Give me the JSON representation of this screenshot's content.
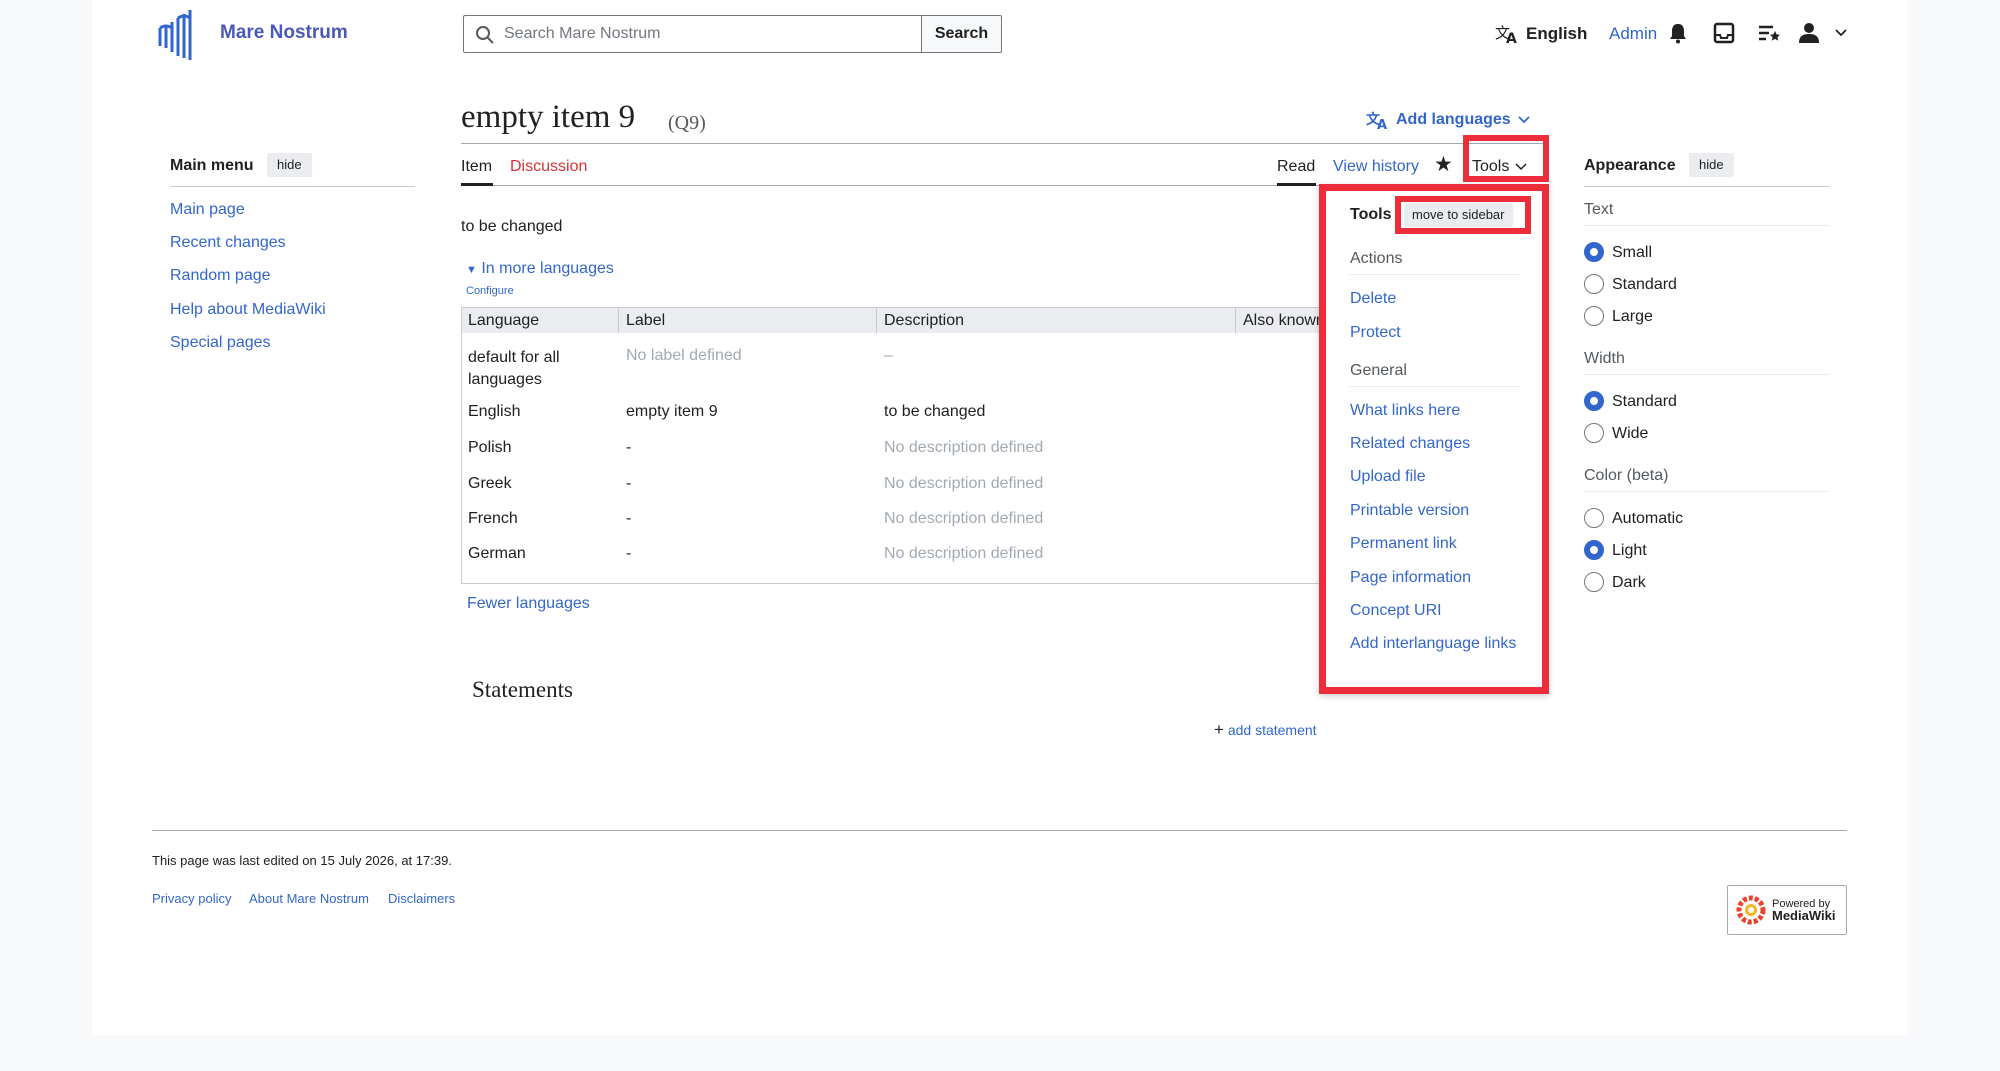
{
  "header": {
    "site_name": "Mare Nostrum",
    "search_placeholder": "Search Mare Nostrum",
    "search_button": "Search",
    "language": "English",
    "user": "Admin"
  },
  "page": {
    "title": "empty item 9",
    "qid": "(Q9)",
    "add_languages": "Add languages",
    "tabs": {
      "item": "Item",
      "discussion": "Discussion",
      "read": "Read",
      "view_history": "View history",
      "tools": "Tools"
    },
    "description": "to be changed",
    "in_more_languages": "In more languages",
    "configure": "Configure",
    "fewer_languages": "Fewer languages",
    "statements_heading": "Statements",
    "add_statement": "add statement"
  },
  "languages_table": {
    "headers": [
      "Language",
      "Label",
      "Description",
      "Also known as"
    ],
    "rows": [
      {
        "language": "default for all languages",
        "label": "No label defined",
        "description": "–"
      },
      {
        "language": "English",
        "label": "empty item 9",
        "description": "to be changed"
      },
      {
        "language": "Polish",
        "label": "-",
        "description": "No description defined"
      },
      {
        "language": "Greek",
        "label": "-",
        "description": "No description defined"
      },
      {
        "language": "French",
        "label": "-",
        "description": "No description defined"
      },
      {
        "language": "German",
        "label": "-",
        "description": "No description defined"
      }
    ]
  },
  "main_menu": {
    "title": "Main menu",
    "hide": "hide",
    "items": [
      "Main page",
      "Recent changes",
      "Random page",
      "Help about MediaWiki",
      "Special pages"
    ]
  },
  "tools_menu": {
    "title": "Tools",
    "move_to_sidebar": "move to sidebar",
    "actions_heading": "Actions",
    "actions": [
      "Delete",
      "Protect"
    ],
    "general_heading": "General",
    "general": [
      "What links here",
      "Related changes",
      "Upload file",
      "Printable version",
      "Permanent link",
      "Page information",
      "Concept URI",
      "Add interlanguage links"
    ]
  },
  "appearance": {
    "title": "Appearance",
    "hide": "hide",
    "text_heading": "Text",
    "text_options": [
      "Small",
      "Standard",
      "Large"
    ],
    "text_selected": "Small",
    "width_heading": "Width",
    "width_options": [
      "Standard",
      "Wide"
    ],
    "width_selected": "Standard",
    "color_heading": "Color (beta)",
    "color_options": [
      "Automatic",
      "Light",
      "Dark"
    ],
    "color_selected": "Light"
  },
  "footer": {
    "last_edited": "This page was last edited on 15 July 2026, at 17:39.",
    "links": [
      "Privacy policy",
      "About Mare Nostrum",
      "Disclaimers"
    ],
    "powered_line1": "Powered by",
    "powered_line2": "MediaWiki"
  },
  "colors": {
    "link": "#3366cc",
    "highlight": "#ee2d3a",
    "discussion": "#d73333"
  }
}
